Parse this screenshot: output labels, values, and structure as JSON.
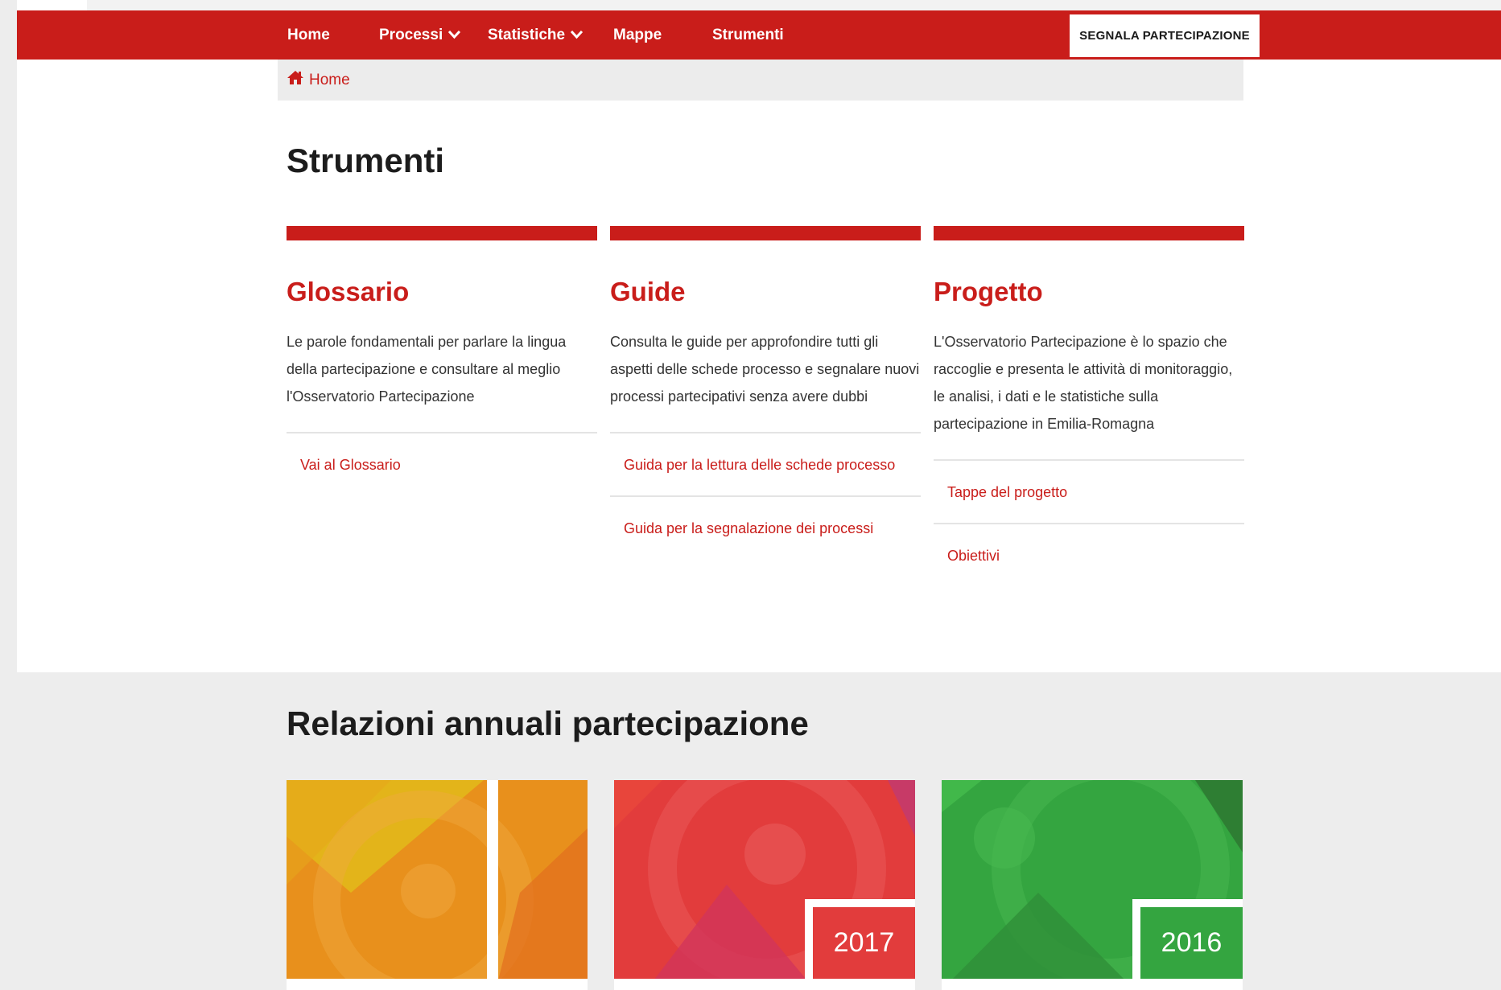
{
  "nav": {
    "items": [
      {
        "label": "Home",
        "dropdown": false
      },
      {
        "label": "Processi",
        "dropdown": true
      },
      {
        "label": "Statistiche",
        "dropdown": true
      },
      {
        "label": "Mappe",
        "dropdown": false
      },
      {
        "label": "Strumenti",
        "dropdown": false
      }
    ],
    "cta_label": "SEGNALA PARTECIPAZIONE"
  },
  "breadcrumb": {
    "icon": "home-icon",
    "label": "Home"
  },
  "page_title": "Strumenti",
  "cards": [
    {
      "title": "Glossario",
      "description": "Le parole fondamentali per parlare la lingua della partecipazione e consultare al meglio l'Osservatorio Partecipazione",
      "links": [
        "Vai al Glossario"
      ]
    },
    {
      "title": "Guide",
      "description": "Consulta le guide per approfondire tutti gli aspetti delle schede processo e segnalare nuovi processi partecipativi senza avere dubbi",
      "links": [
        "Guida per la lettura delle schede processo",
        "Guida per la segnalazione dei processi"
      ]
    },
    {
      "title": "Progetto",
      "description": "L'Osservatorio Partecipazione è lo spazio che raccoglie e presenta le attività di monitoraggio, le analisi, i dati e le statistiche sulla partecipazione in Emilia-Romagna",
      "links": [
        "Tappe del progetto",
        "Obiettivi"
      ]
    }
  ],
  "relazioni": {
    "title": "Relazioni annuali partecipazione",
    "reports": [
      {
        "year": "",
        "color": "#e8901c"
      },
      {
        "year": "2017",
        "color": "#e23c3c"
      },
      {
        "year": "2016",
        "color": "#34a540"
      }
    ]
  },
  "colors": {
    "brand_red": "#c91d1a",
    "light_gray": "#ededed"
  }
}
